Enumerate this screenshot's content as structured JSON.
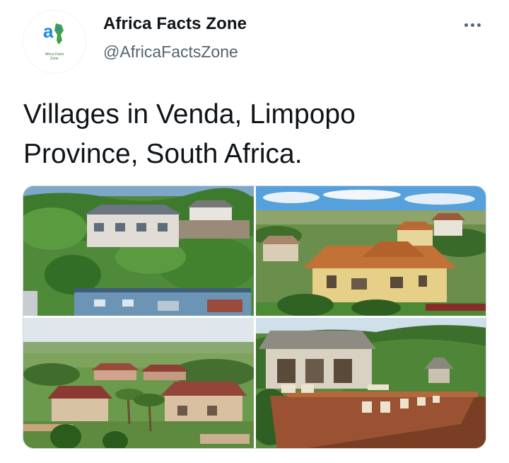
{
  "author": {
    "display_name": "Africa Facts Zone",
    "handle": "@AfricaFactsZone",
    "avatar_brand_text": "Africa Facts Zone",
    "avatar_logo_text": "afz"
  },
  "more_icon": "more-horizontal-icon",
  "tweet": {
    "text": "Villages in Venda, Limpopo Province, South Africa."
  },
  "media": {
    "photos": [
      {
        "subject": "village-houses-on-green-hillside"
      },
      {
        "subject": "tiled-roof-villa-aerial-view"
      },
      {
        "subject": "aerial-village-with-palm-trees"
      },
      {
        "subject": "lodge-wooden-deck-mountains"
      }
    ]
  },
  "colors": {
    "text_primary": "#0f1419",
    "text_secondary": "#536471",
    "border": "#cfd9de",
    "logo_blue": "#1e88e5",
    "logo_green": "#43a047"
  }
}
